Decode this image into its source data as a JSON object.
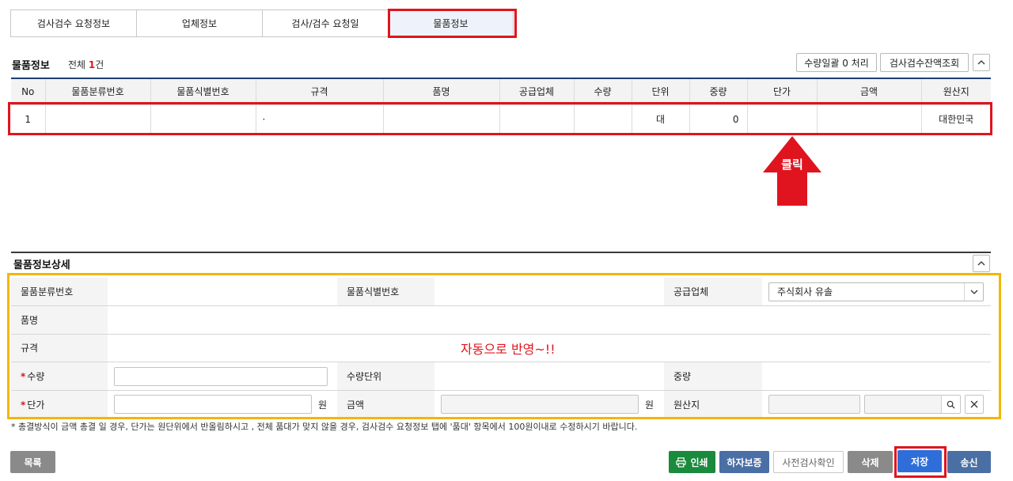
{
  "tabs": [
    {
      "label": "검사검수 요청정보",
      "active": false
    },
    {
      "label": "업체정보",
      "active": false
    },
    {
      "label": "검사/검수 요청일",
      "active": false
    },
    {
      "label": "물품정보",
      "active": true
    }
  ],
  "list_section": {
    "title": "물품정보",
    "total_prefix": "전체 ",
    "total_count": "1",
    "total_suffix": "건",
    "qty_batch_button": "수량일괄 0 처리",
    "balance_button": "검사검수잔액조회"
  },
  "list_table": {
    "headers": [
      "No",
      "물품분류번호",
      "물품식별번호",
      "규격",
      "품명",
      "공급업체",
      "수량",
      "단위",
      "중량",
      "단가",
      "금액",
      "원산지"
    ],
    "rows": [
      [
        "1",
        "",
        "",
        "·",
        "",
        "",
        "",
        "대",
        "0",
        "",
        "",
        "대한민국"
      ]
    ]
  },
  "annotation": {
    "click_label": "클릭",
    "auto_reflect": "자동으로 반영~!!"
  },
  "detail_section": {
    "title": "물품정보상세",
    "labels": {
      "category_no": "물품분류번호",
      "identifier_no": "물품식별번호",
      "supplier": "공급업체",
      "item_name": "품명",
      "spec": "규격",
      "quantity": "수량",
      "qty_unit": "수량단위",
      "weight": "중량",
      "unit_price": "단가",
      "amount": "금액",
      "origin": "원산지"
    },
    "supplier_value": "주식회사 유솔",
    "won": "원"
  },
  "note": "* 총결방식이 금액 총결 일 경우, 단가는 원단위에서 반올림하시고 , 전체 품대가 맞지 않을 경우, 검사검수 요청정보 탭에 '품대' 항목에서 100원이내로 수정하시기 바랍니다.",
  "footer": {
    "list": "목록",
    "print": "인쇄",
    "warranty": "하자보증",
    "pre_inspect": "사전검사확인",
    "delete": "삭제",
    "save": "저장",
    "send": "송신"
  },
  "colors": {
    "accent_navy": "#1f3f73",
    "annotation_red": "#e0141e",
    "annotation_yellow": "#f2b705",
    "print_green": "#1a8a3c",
    "blue_button": "#4a6fa5",
    "save_blue": "#2f6ed8",
    "gray_button": "#8a8a8a"
  }
}
